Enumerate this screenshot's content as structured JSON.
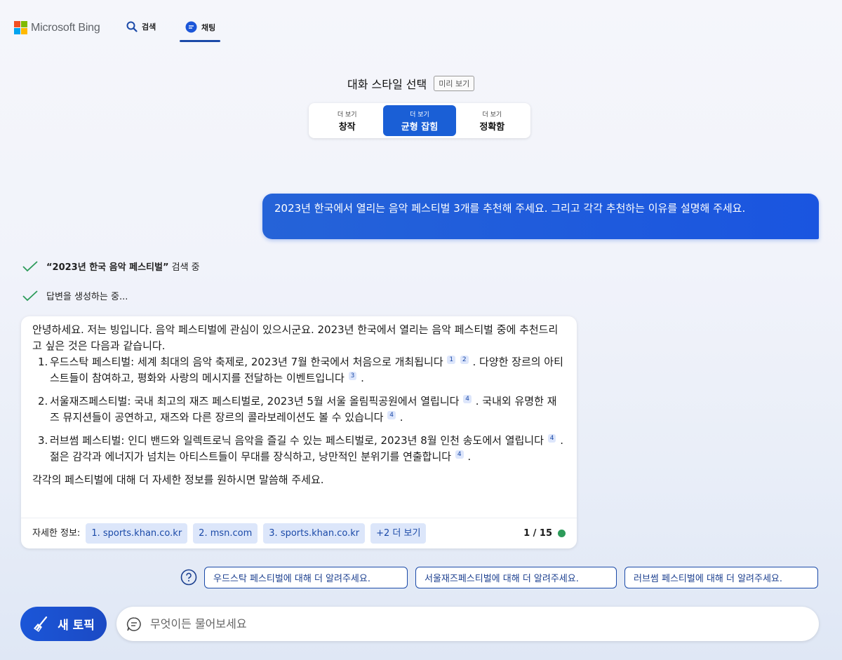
{
  "header": {
    "brand": "Microsoft Bing",
    "nav_search": "검색",
    "nav_chat": "채팅"
  },
  "style_selector": {
    "title": "대화 스타일 선택",
    "preview_badge": "미리 보기",
    "options": [
      {
        "small": "더 보기",
        "label": "창작",
        "active": false
      },
      {
        "small": "더 보기",
        "label": "균형 잡힘",
        "active": true
      },
      {
        "small": "더 보기",
        "label": "정확함",
        "active": false
      }
    ]
  },
  "user_message": "2023년 한국에서 열리는 음악 페스티벌 3개를 추천해 주세요. 그리고 각각 추천하는 이유를 설명해 주세요.",
  "status": {
    "searching_query": "“2023년 한국 음악 페스티벌”",
    "searching_suffix": " 검색 중",
    "generating": "답변을 생성하는 중..."
  },
  "answer": {
    "intro": "안녕하세요. 저는 빙입니다. 음악 페스티벌에 관심이 있으시군요. 2023년 한국에서 열리는 음악 페스티벌 중에 추천드리고 싶은 것은 다음과 같습니다.",
    "items": [
      {
        "num": "1.",
        "part1": "우드스탁 페스티벌: 세계 최대의 음악 축제로, 2023년 7월 한국에서 처음으로 개최됩니다",
        "cite1": "1",
        "cite2": "2",
        "part2": ". 다양한 장르의 아티스트들이 참여하고, 평화와 사랑의 메시지를 전달하는 이벤트입니다",
        "cite3": "3",
        "part3": "."
      },
      {
        "num": "2.",
        "part1": "서울재즈페스티벌: 국내 최고의 재즈 페스티벌로, 2023년 5월 서울 올림픽공원에서 열립니다",
        "cite1": "4",
        "part2": ". 국내외 유명한 재즈 뮤지션들이 공연하고, 재즈와 다른 장르의 콜라보레이션도 볼 수 있습니다",
        "cite2": "4",
        "part3": "."
      },
      {
        "num": "3.",
        "part1": "러브썸 페스티벌: 인디 밴드와 일렉트로닉 음악을 즐길 수 있는 페스티벌로, 2023년 8월 인천 송도에서 열립니다",
        "cite1": "4",
        "part2": ". 젊은 감각과 에너지가 넘치는 아티스트들이 무대를 장식하고, 낭만적인 분위기를 연출합니다",
        "cite2": "4",
        "part3": "."
      }
    ],
    "closing": "각각의 페스티벌에 대해 더 자세한 정보를 원하시면 말씀해 주세요.",
    "sources_label": "자세한 정보:",
    "sources": [
      "1. sports.khan.co.kr",
      "2. msn.com",
      "3. sports.khan.co.kr"
    ],
    "more": "+2 더 보기",
    "counter": "1 / 15"
  },
  "suggestions": [
    "우드스탁 페스티벌에 대해 더 알려주세요.",
    "서울재즈페스티벌에 대해 더 알려주세요.",
    "러브썸 페스티벌에 대해 더 알려주세요."
  ],
  "composer": {
    "new_topic": "새 토픽",
    "placeholder": "무엇이든 물어보세요"
  },
  "colors": {
    "accent": "#1a5fd6",
    "user_bubble": "#2563d8",
    "check": "#2d9b5a",
    "chip_bg": "#dce6fa"
  }
}
